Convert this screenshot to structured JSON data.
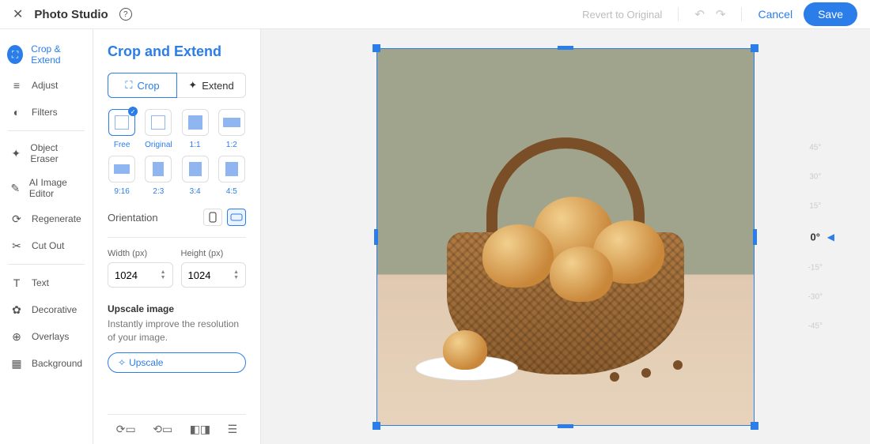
{
  "header": {
    "title": "Photo Studio",
    "revert": "Revert to Original",
    "cancel": "Cancel",
    "save": "Save"
  },
  "sidebar": {
    "items": [
      {
        "label": "Crop & Extend",
        "icon": "crop-icon",
        "active": true
      },
      {
        "label": "Adjust",
        "icon": "adjust-icon"
      },
      {
        "label": "Filters",
        "icon": "filters-icon"
      },
      {
        "sep": true
      },
      {
        "label": "Object Eraser",
        "icon": "eraser-icon"
      },
      {
        "label": "AI Image Editor",
        "icon": "ai-icon"
      },
      {
        "label": "Regenerate",
        "icon": "regenerate-icon"
      },
      {
        "label": "Cut Out",
        "icon": "cutout-icon"
      },
      {
        "sep": true
      },
      {
        "label": "Text",
        "icon": "text-icon"
      },
      {
        "label": "Decorative",
        "icon": "decorative-icon"
      },
      {
        "label": "Overlays",
        "icon": "overlays-icon"
      },
      {
        "label": "Background",
        "icon": "background-icon"
      }
    ]
  },
  "panel": {
    "title": "Crop and Extend",
    "tabs": {
      "crop": "Crop",
      "extend": "Extend",
      "active": "crop"
    },
    "ratios": [
      {
        "label": "Free",
        "w": 18,
        "h": 18,
        "outline": true,
        "active": true
      },
      {
        "label": "Original",
        "w": 18,
        "h": 18,
        "outline": true
      },
      {
        "label": "1:1",
        "w": 18,
        "h": 18
      },
      {
        "label": "1:2",
        "w": 22,
        "h": 12
      },
      {
        "label": "9:16",
        "w": 20,
        "h": 12
      },
      {
        "label": "2:3",
        "w": 14,
        "h": 18
      },
      {
        "label": "3:4",
        "w": 16,
        "h": 18
      },
      {
        "label": "4:5",
        "w": 16,
        "h": 18
      }
    ],
    "orientation": {
      "label": "Orientation",
      "active": "landscape"
    },
    "width": {
      "label": "Width (px)",
      "value": "1024"
    },
    "height": {
      "label": "Height (px)",
      "value": "1024"
    },
    "upscale": {
      "title": "Upscale image",
      "desc": "Instantly improve the resolution of your image.",
      "button": "Upscale"
    }
  },
  "rotate": {
    "ticks": [
      "45°",
      "30°",
      "15°",
      "0°",
      "-15°",
      "-30°",
      "-45°"
    ],
    "current": "0°"
  }
}
